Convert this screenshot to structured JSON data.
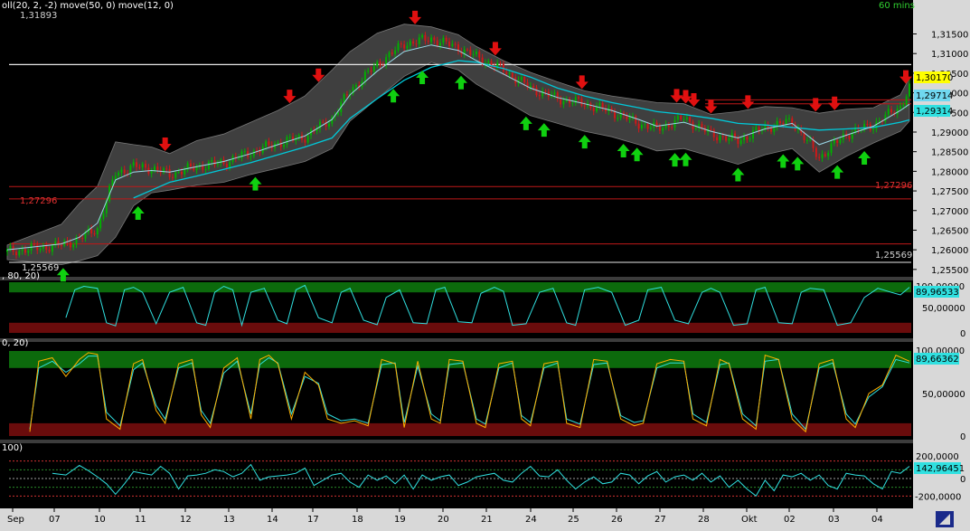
{
  "colors": {
    "background": "#000000",
    "axis_panel": "#d8d8d8",
    "band_fill": "#4a4a4a",
    "sma_line": "#00c8d8",
    "price_up": "#00b000",
    "price_down": "#d01818",
    "sell_arrow": "#e01010",
    "buy_arrow": "#10d010",
    "overbought_zone": "#0c6a0c",
    "oversold_zone": "#6a0c0c",
    "stoch_k": "#ffb000",
    "stoch_d": "#30e0e0"
  },
  "main_panel": {
    "indicator_text": "oll(20, 2, -2) move(50, 0) move(12, 0)",
    "timeframe": "60 mins",
    "high_label": "1,31893",
    "low_label": "1,25569",
    "level_left_label": "1,27296",
    "level_right_label": "1,27296",
    "clipped_left_label": "1,25569",
    "price_tag_yellow": "1,30170",
    "price_tag_blue1": "1,29714",
    "price_tag_blue2": "1,29314",
    "y_ticks": [
      "1,31500",
      "1,31000",
      "1,30500",
      "1,30000",
      "1,29500",
      "1,29000",
      "1,28500",
      "1,28000",
      "1,27500",
      "1,27000",
      "1,26500",
      "1,26000",
      "1,25500"
    ]
  },
  "rsi_panel": {
    "label": ", 80, 20)",
    "value_tag": "89,96533",
    "top_tag": "100,00000",
    "y_ticks": [
      "50,00000",
      "0"
    ]
  },
  "stoch_panel": {
    "label": "0, 20)",
    "value_tag": "89,66362",
    "top_tag": "100,00000",
    "y_ticks": [
      "50,00000",
      "0"
    ]
  },
  "cci_panel": {
    "label": "100)",
    "value_tag": "142,96451",
    "top_tag": "200,0000",
    "y_ticks": [
      "0",
      "-200,0000"
    ]
  },
  "x_axis": {
    "ticks": [
      "Sep",
      "07",
      "10",
      "11",
      "12",
      "13",
      "14",
      "17",
      "18",
      "19",
      "20",
      "21",
      "24",
      "25",
      "26",
      "27",
      "28",
      "Okt",
      "02",
      "03",
      "04"
    ]
  },
  "chart_data": {
    "type": "line",
    "title": "",
    "timeframe": "60 mins",
    "x_ticks": [
      "Sep",
      "07",
      "10",
      "11",
      "12",
      "13",
      "14",
      "17",
      "18",
      "19",
      "20",
      "21",
      "24",
      "25",
      "26",
      "27",
      "28",
      "Okt",
      "02",
      "03",
      "04"
    ],
    "price": {
      "ylim": [
        1.2545,
        1.3195
      ],
      "annotated_high": 1.31893,
      "annotated_low": 1.25569,
      "horizontal_levels": [
        1.3072,
        1.27296,
        1.2761,
        1.2615
      ],
      "x_index": [
        0,
        6,
        8,
        10,
        12,
        14,
        16,
        18,
        21,
        24,
        27,
        30,
        33,
        36,
        38,
        41,
        44,
        47,
        50,
        52,
        55,
        58,
        61,
        64,
        67,
        70,
        72,
        75,
        78,
        81,
        84,
        87,
        90,
        93,
        96,
        99,
        100
      ],
      "close": [
        1.2595,
        1.2612,
        1.2628,
        1.2655,
        1.2795,
        1.2812,
        1.2808,
        1.2792,
        1.2812,
        1.2822,
        1.2848,
        1.2872,
        1.2888,
        1.2935,
        1.3005,
        1.3072,
        1.3125,
        1.3138,
        1.3115,
        1.3092,
        1.3058,
        1.3012,
        1.2985,
        1.2972,
        1.2952,
        1.2922,
        1.2908,
        1.2935,
        1.2895,
        1.2878,
        1.2912,
        1.2928,
        1.2835,
        1.2895,
        1.2918,
        1.2965,
        1.3012
      ],
      "upper_band": [
        1.2612,
        1.2665,
        1.2718,
        1.2762,
        1.2875,
        1.2868,
        1.2862,
        1.2845,
        1.2878,
        1.2895,
        1.2925,
        1.2955,
        1.2992,
        1.3058,
        1.3105,
        1.3152,
        1.3175,
        1.3168,
        1.3148,
        1.3118,
        1.3082,
        1.3052,
        1.3028,
        1.3005,
        1.2992,
        1.2982,
        1.2975,
        1.2972,
        1.2945,
        1.2952,
        1.2965,
        1.2962,
        1.2948,
        1.2958,
        1.2962,
        1.2995,
        1.3038
      ],
      "lower_band": [
        1.2575,
        1.2562,
        1.2572,
        1.2585,
        1.2632,
        1.2712,
        1.2745,
        1.2752,
        1.2765,
        1.2772,
        1.2792,
        1.2808,
        1.2825,
        1.2858,
        1.2928,
        1.2985,
        1.3042,
        1.3078,
        1.3058,
        1.3022,
        1.2982,
        1.2942,
        1.2922,
        1.2902,
        1.2888,
        1.2868,
        1.2852,
        1.2858,
        1.2838,
        1.2818,
        1.2842,
        1.2858,
        1.2798,
        1.2838,
        1.2872,
        1.2902,
        1.2928
      ],
      "sma50": [
        null,
        null,
        null,
        null,
        null,
        1.2732,
        1.2752,
        1.2772,
        1.2788,
        1.2805,
        1.2822,
        1.2842,
        1.2862,
        1.2885,
        1.2935,
        1.2985,
        1.3032,
        1.3065,
        1.3082,
        1.3078,
        1.3062,
        1.304,
        1.3012,
        1.2992,
        1.2975,
        1.2962,
        1.2952,
        1.2945,
        1.2935,
        1.2922,
        1.2918,
        1.2912,
        1.2905,
        1.2908,
        1.2912,
        1.2925,
        1.2931
      ],
      "sma12": [
        1.26,
        1.2615,
        1.2632,
        1.2668,
        1.2778,
        1.2798,
        1.2802,
        1.2798,
        1.2812,
        1.2825,
        1.2845,
        1.2868,
        1.289,
        1.2932,
        1.2995,
        1.3055,
        1.3105,
        1.3122,
        1.3108,
        1.3082,
        1.3048,
        1.3012,
        1.2988,
        1.2972,
        1.2955,
        1.2932,
        1.2915,
        1.2925,
        1.2902,
        1.2885,
        1.2908,
        1.2922,
        1.2868,
        1.2892,
        1.2915,
        1.2955,
        1.2971
      ],
      "sell_signal_x": [
        31.3,
        34.5,
        17.5,
        45.2,
        54.1,
        63.7,
        74.2,
        75.2,
        76.1,
        78.0,
        82.1,
        89.6,
        91.7,
        99.6
      ],
      "buy_signal_x": [
        6.2,
        14.5,
        27.5,
        42.8,
        46.0,
        50.3,
        57.5,
        59.5,
        64.0,
        68.3,
        69.8,
        74.0,
        75.2,
        81.0,
        86.0,
        87.6,
        92.0,
        95.0
      ]
    },
    "rsi": {
      "ylim": [
        0,
        100
      ],
      "zones": {
        "overbought": [
          80,
          100
        ],
        "oversold": [
          0,
          20
        ]
      },
      "x_index": [
        6.5,
        7.5,
        8.5,
        10,
        11,
        12,
        13,
        14,
        15,
        16.5,
        18,
        19.5,
        21,
        22,
        23,
        24,
        25,
        26,
        27,
        28.5,
        30,
        31,
        32,
        33,
        34.5,
        36,
        37,
        38,
        39.5,
        41,
        42,
        43.5,
        45,
        46.5,
        47.5,
        48.5,
        50,
        51.5,
        52.5,
        54,
        55,
        56,
        57.5,
        59,
        60.5,
        62,
        63,
        64,
        65.5,
        67,
        68.5,
        70,
        71,
        72.5,
        74,
        75.5,
        77,
        78,
        79,
        80.5,
        82,
        83,
        84,
        85.5,
        87,
        88,
        89,
        90.5,
        92,
        93.5,
        95,
        96.5,
        98,
        99,
        100
      ],
      "values": [
        30,
        85,
        92,
        88,
        20,
        14,
        85,
        90,
        80,
        18,
        80,
        90,
        20,
        15,
        80,
        92,
        85,
        15,
        80,
        88,
        25,
        18,
        85,
        94,
        30,
        20,
        80,
        88,
        25,
        16,
        70,
        85,
        20,
        18,
        85,
        90,
        22,
        20,
        78,
        90,
        82,
        15,
        18,
        80,
        88,
        20,
        15,
        85,
        90,
        80,
        15,
        25,
        85,
        90,
        25,
        18,
        80,
        88,
        80,
        15,
        18,
        85,
        90,
        20,
        18,
        80,
        88,
        85,
        15,
        20,
        70,
        88,
        80,
        75,
        90
      ]
    },
    "stochastic": {
      "ylim": [
        0,
        100
      ],
      "zones": {
        "overbought": [
          80,
          100
        ],
        "oversold": [
          0,
          15
        ]
      },
      "x_index": [
        2.5,
        3.5,
        5,
        6.5,
        8,
        9,
        10,
        11,
        12.5,
        14,
        15,
        16.5,
        17.5,
        19,
        20.5,
        21.5,
        22.5,
        24,
        25.5,
        27,
        28,
        29,
        30,
        31.5,
        33,
        34.5,
        35.5,
        37,
        38.5,
        40,
        41.5,
        43,
        44,
        45.5,
        47,
        48,
        49,
        50.5,
        52,
        53,
        54.5,
        56,
        57,
        58,
        59.5,
        61,
        62,
        63.5,
        65,
        66.5,
        68,
        69.5,
        70.5,
        72,
        73.5,
        75,
        76,
        77.5,
        79,
        80,
        81.5,
        83,
        84,
        85.5,
        87,
        88.5,
        90,
        91.5,
        93,
        94,
        95.5,
        97,
        98.5,
        100
      ],
      "k": [
        5,
        88,
        92,
        70,
        90,
        98,
        96,
        20,
        8,
        85,
        90,
        30,
        15,
        85,
        90,
        25,
        10,
        80,
        92,
        20,
        90,
        95,
        85,
        20,
        75,
        60,
        20,
        15,
        18,
        12,
        90,
        85,
        10,
        88,
        20,
        15,
        90,
        88,
        15,
        10,
        85,
        88,
        20,
        12,
        85,
        88,
        15,
        10,
        90,
        88,
        20,
        12,
        15,
        85,
        90,
        88,
        20,
        12,
        90,
        85,
        20,
        8,
        95,
        90,
        20,
        5,
        85,
        90,
        20,
        10,
        50,
        60,
        95,
        88
      ],
      "d": [
        8,
        80,
        88,
        75,
        85,
        94,
        94,
        28,
        12,
        78,
        86,
        36,
        20,
        80,
        86,
        30,
        15,
        74,
        88,
        26,
        84,
        92,
        86,
        26,
        70,
        62,
        26,
        18,
        20,
        15,
        84,
        86,
        16,
        82,
        26,
        18,
        84,
        86,
        20,
        14,
        80,
        86,
        24,
        16,
        80,
        86,
        20,
        14,
        84,
        86,
        24,
        16,
        18,
        80,
        86,
        86,
        26,
        16,
        84,
        86,
        26,
        12,
        88,
        90,
        26,
        8,
        80,
        86,
        26,
        14,
        46,
        58,
        90,
        86
      ]
    },
    "cci": {
      "ylim": [
        -300,
        300
      ],
      "guides": [
        200,
        100,
        0,
        -100,
        -200
      ],
      "x_index": [
        5,
        6.5,
        8,
        9,
        10,
        11,
        12,
        13,
        14,
        15,
        16,
        17,
        18,
        19,
        20,
        21,
        22,
        23,
        24,
        25,
        26,
        27,
        28,
        29,
        30,
        31,
        32,
        33,
        34,
        35,
        36,
        37,
        38,
        39,
        40,
        41,
        42,
        43,
        44,
        45,
        46,
        47,
        48,
        49,
        50,
        51,
        52,
        53,
        54,
        55,
        56,
        57,
        58,
        59,
        60,
        61,
        62,
        63,
        64,
        65,
        66,
        67,
        68,
        69,
        70,
        71,
        72,
        73,
        74,
        75,
        76,
        77,
        78,
        79,
        80,
        81,
        82,
        83,
        84,
        85,
        86,
        87,
        88,
        89,
        90,
        91,
        92,
        93,
        94,
        95,
        96,
        97,
        98,
        99,
        100
      ],
      "values": [
        60,
        40,
        150,
        90,
        20,
        -60,
        -180,
        -60,
        80,
        60,
        40,
        140,
        60,
        -120,
        30,
        40,
        60,
        100,
        80,
        20,
        60,
        160,
        -20,
        20,
        30,
        40,
        60,
        120,
        -80,
        -20,
        40,
        60,
        -40,
        -100,
        40,
        -20,
        30,
        -60,
        40,
        -120,
        40,
        -20,
        20,
        40,
        -80,
        -40,
        20,
        40,
        60,
        -20,
        -40,
        60,
        140,
        30,
        20,
        100,
        -20,
        -120,
        -40,
        20,
        -60,
        -40,
        60,
        40,
        -60,
        30,
        80,
        -40,
        20,
        40,
        -20,
        60,
        -40,
        30,
        -100,
        -20,
        -120,
        -200,
        -20,
        -140,
        40,
        20,
        60,
        -20,
        40,
        -80,
        -120,
        60,
        40,
        30,
        -60,
        -120,
        80,
        60,
        140
      ]
    }
  }
}
